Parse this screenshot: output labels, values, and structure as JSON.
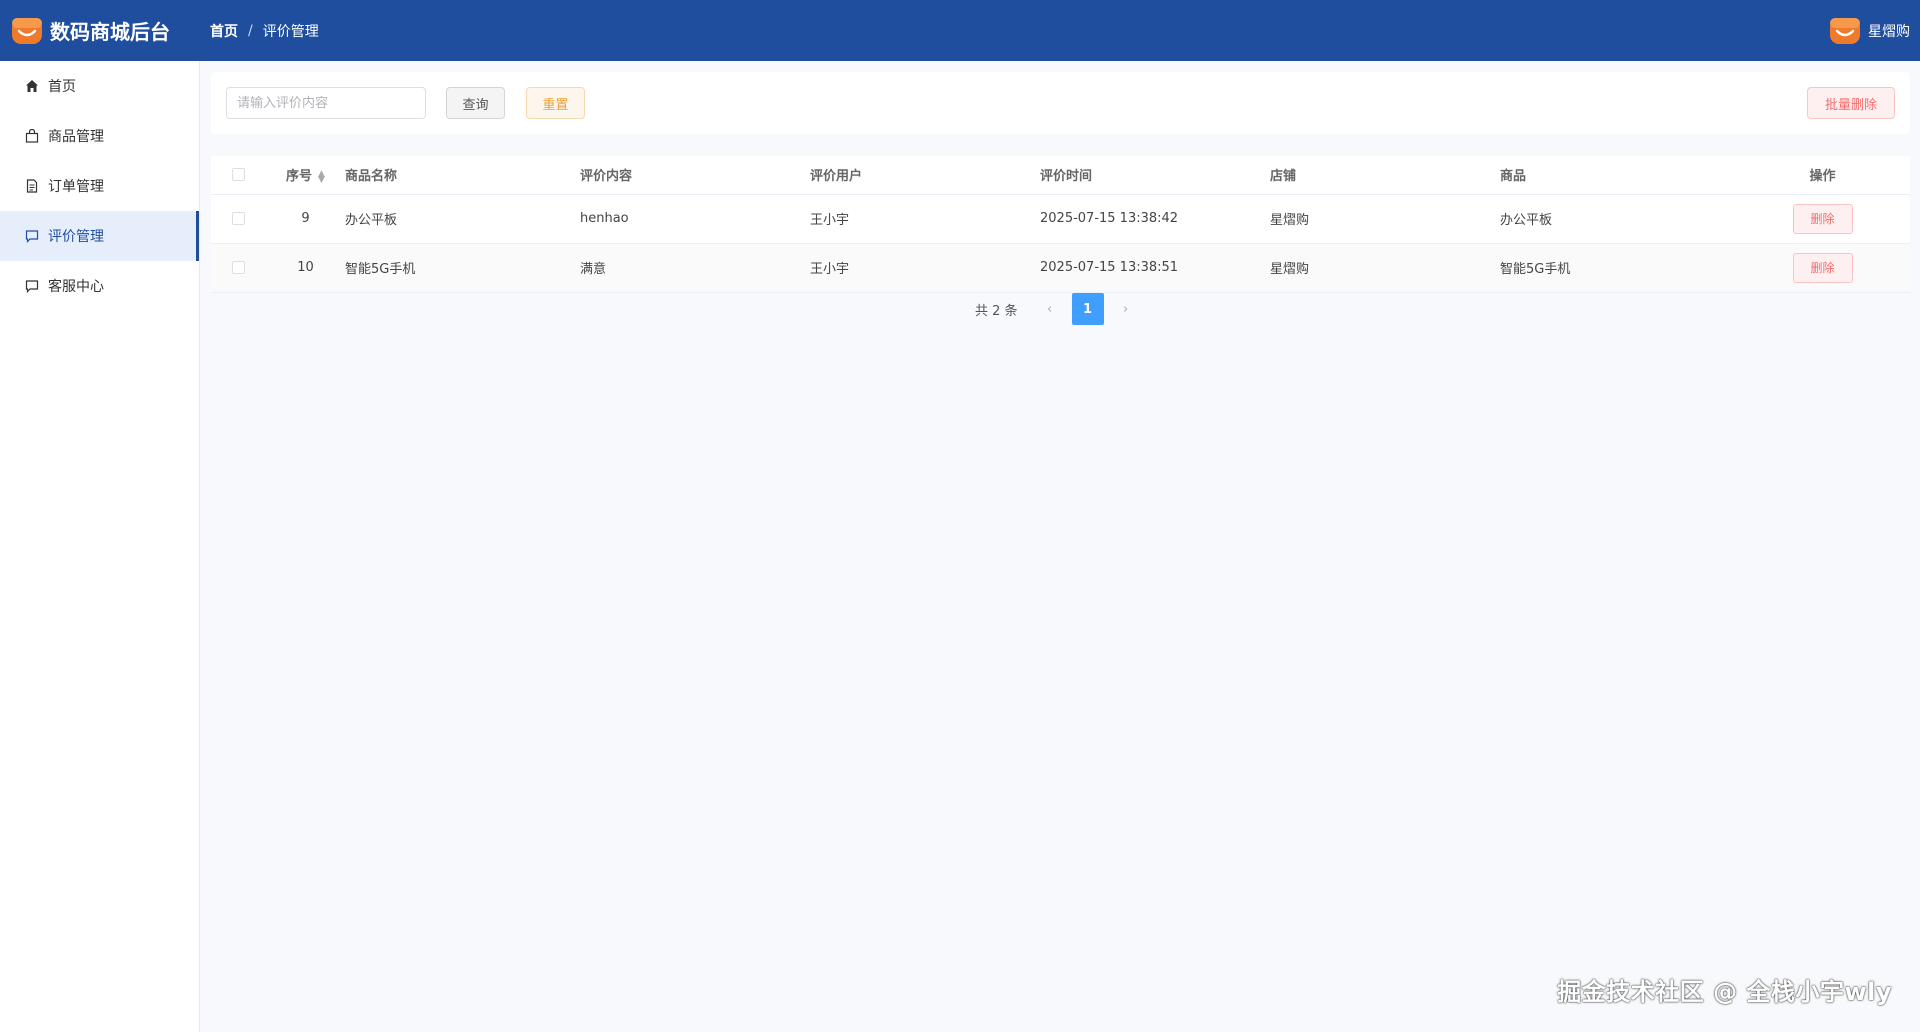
{
  "header": {
    "brand_title": "数码商城后台",
    "breadcrumb": {
      "home": "首页",
      "separator": "/",
      "current": "评价管理"
    },
    "user_name": "星熠购",
    "background_color": "#1f4e9e"
  },
  "sidebar": {
    "items": [
      {
        "label": "首页",
        "icon": "home-icon"
      },
      {
        "label": "商品管理",
        "icon": "shopping-bag-icon"
      },
      {
        "label": "订单管理",
        "icon": "document-icon"
      },
      {
        "label": "评价管理",
        "icon": "chat-icon",
        "active": true
      },
      {
        "label": "客服中心",
        "icon": "chat-icon"
      }
    ]
  },
  "toolbar": {
    "search_placeholder": "请输入评价内容",
    "query_label": "查询",
    "reset_label": "重置",
    "batch_delete_label": "批量删除"
  },
  "table": {
    "columns": [
      "序号",
      "商品名称",
      "评价内容",
      "评价用户",
      "评价时间",
      "店铺",
      "商品",
      "操作"
    ],
    "rows": [
      {
        "id": "9",
        "product_name": "办公平板",
        "content": "henhao",
        "user": "王小宇",
        "time": "2025-07-15 13:38:42",
        "store": "星熠购",
        "product": "办公平板",
        "action": "删除"
      },
      {
        "id": "10",
        "product_name": "智能5G手机",
        "content": "满意",
        "user": "王小宇",
        "time": "2025-07-15 13:38:51",
        "store": "星熠购",
        "product": "智能5G手机",
        "action": "删除"
      }
    ]
  },
  "pagination": {
    "total_text": "共 2 条",
    "current_page": "1",
    "prev": "‹",
    "next": "›"
  },
  "watermark": "掘金技术社区 @ 全栈小宇wly"
}
